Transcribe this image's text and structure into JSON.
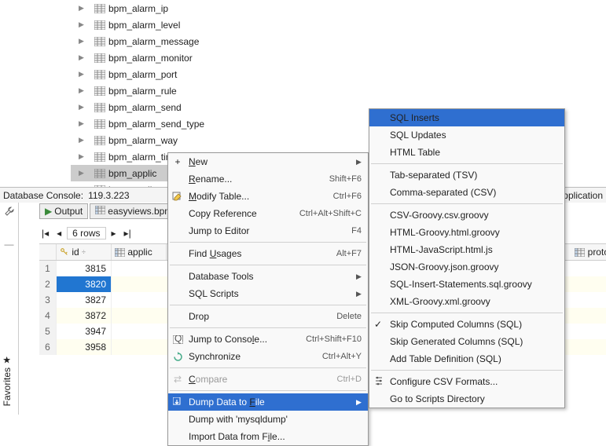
{
  "tree": {
    "items": [
      {
        "label": "bpm_alarm_ip"
      },
      {
        "label": "bpm_alarm_level"
      },
      {
        "label": "bpm_alarm_message"
      },
      {
        "label": "bpm_alarm_monitor"
      },
      {
        "label": "bpm_alarm_port"
      },
      {
        "label": "bpm_alarm_rule"
      },
      {
        "label": "bpm_alarm_send"
      },
      {
        "label": "bpm_alarm_send_type"
      },
      {
        "label": "bpm_alarm_way"
      },
      {
        "label": "bpm_alarm_time"
      },
      {
        "label": "bpm_applic"
      },
      {
        "label": "bpm_applic"
      }
    ]
  },
  "dbc": {
    "title": "Database Console:",
    "host": "119.3.223"
  },
  "tabs": {
    "output": "Output",
    "easy": "easyviews.bpm"
  },
  "nav": {
    "rows": "6 rows"
  },
  "grid": {
    "col_id": "id",
    "col_app": "applic",
    "col_proto": "proto",
    "rows": [
      {
        "n": "1",
        "id": "3815"
      },
      {
        "n": "2",
        "id": "3820"
      },
      {
        "n": "3",
        "id": "3827"
      },
      {
        "n": "4",
        "id": "3872"
      },
      {
        "n": "5",
        "id": "3947"
      },
      {
        "n": "6",
        "id": "3958"
      }
    ]
  },
  "tail": {
    "application": "application"
  },
  "menu": {
    "new": "New",
    "rename": "Rename...",
    "rename_hint": "Shift+F6",
    "modify": "Modify Table...",
    "modify_hint": "Ctrl+F6",
    "copyref": "Copy Reference",
    "copyref_hint": "Ctrl+Alt+Shift+C",
    "jump": "Jump to Editor",
    "jump_hint": "F4",
    "usages": "Find Usages",
    "usages_hint": "Alt+F7",
    "dbtools": "Database Tools",
    "sqlscripts": "SQL Scripts",
    "drop": "Drop",
    "drop_hint": "Delete",
    "jconsole": "Jump to Console...",
    "jconsole_hint": "Ctrl+Shift+F10",
    "sync": "Synchronize",
    "sync_hint": "Ctrl+Alt+Y",
    "compare": "Compare",
    "compare_hint": "Ctrl+D",
    "dump": "Dump Data to File",
    "dumpmysql": "Dump with 'mysqldump'",
    "import": "Import Data from File..."
  },
  "sub": {
    "sqlins": "SQL Inserts",
    "sqlupd": "SQL Updates",
    "html": "HTML Table",
    "tsv": "Tab-separated (TSV)",
    "csv": "Comma-separated (CSV)",
    "csvg": "CSV-Groovy.csv.groovy",
    "htmlg": "HTML-Groovy.html.groovy",
    "htmljs": "HTML-JavaScript.html.js",
    "jsong": "JSON-Groovy.json.groovy",
    "sqlg": "SQL-Insert-Statements.sql.groovy",
    "xmlg": "XML-Groovy.xml.groovy",
    "skipc": "Skip Computed Columns (SQL)",
    "skipg": "Skip Generated Columns (SQL)",
    "addtd": "Add Table Definition (SQL)",
    "cfg": "Configure CSV Formats...",
    "goto": "Go to Scripts Directory"
  },
  "fav": {
    "label": "Favorites"
  }
}
